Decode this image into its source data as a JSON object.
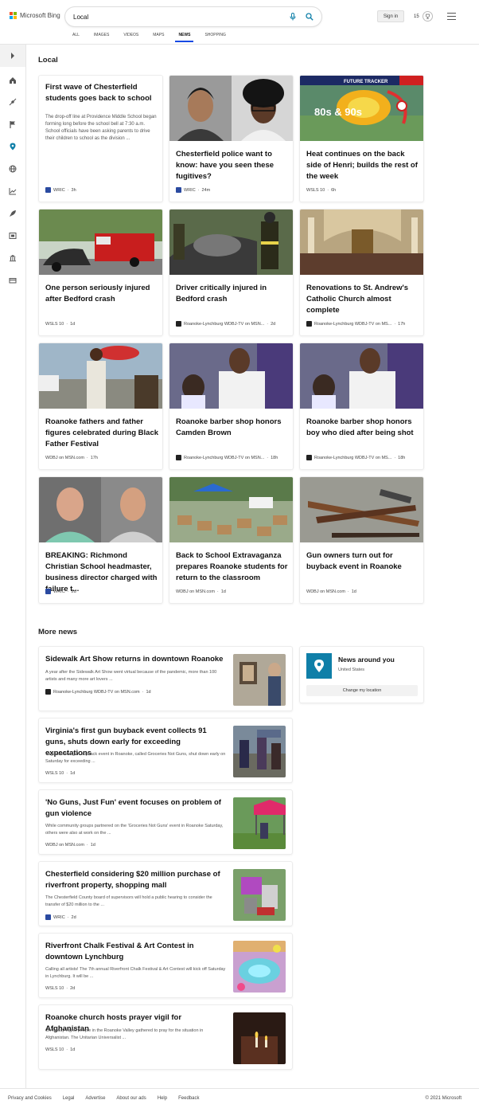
{
  "header": {
    "brand": "Microsoft Bing",
    "search_value": "Local",
    "signin_label": "Sign in",
    "rewards_count": "15",
    "tabs": [
      {
        "label": "ALL",
        "active": false
      },
      {
        "label": "IMAGES",
        "active": false
      },
      {
        "label": "VIDEOS",
        "active": false
      },
      {
        "label": "MAPS",
        "active": false
      },
      {
        "label": "NEWS",
        "active": true
      },
      {
        "label": "SHOPPING",
        "active": false
      }
    ]
  },
  "sidebar": {
    "icons": [
      "expand-icon",
      "home-icon",
      "satellite-icon",
      "flag-icon",
      "location-icon",
      "globe-icon",
      "chart-icon",
      "rocket-icon",
      "film-icon",
      "bank-icon",
      "money-icon"
    ]
  },
  "local": {
    "title": "Local",
    "cards": [
      {
        "title": "First wave of Chesterfield students goes back to school",
        "snippet": "The drop-off line at Providence Middle School began forming long before the school bell at 7:30 a.m. School officials have been asking parents to drive their children to school as the division ...",
        "source": "WRIC",
        "time": "3h"
      },
      {
        "title": "Chesterfield police want to know: have you seen these fugitives?",
        "source": "WRIC",
        "time": "24m"
      },
      {
        "title": "Heat continues on the back side of Henri; builds the rest of the week",
        "source": "WSLS 10",
        "time": "6h",
        "img_text": "80s & 90s",
        "banner_text": "FUTURE TRACKER"
      },
      {
        "title": "One person seriously injured after Bedford crash",
        "source": "WSLS 10",
        "time": "1d"
      },
      {
        "title": "Driver critically injured in Bedford crash",
        "source": "Roanoke-Lynchburg WDBJ-TV on MSN...",
        "time": "2d"
      },
      {
        "title": "Renovations to St. Andrew's Catholic Church almost complete",
        "source": "Roanoke-Lynchburg WDBJ-TV on MS...",
        "time": "17h"
      },
      {
        "title": "Roanoke fathers and father figures celebrated during Black Father Festival",
        "source": "WDBJ on MSN.com",
        "time": "17h"
      },
      {
        "title": "Roanoke barber shop honors Camden Brown",
        "source": "Roanoke-Lynchburg WDBJ-TV on MSN...",
        "time": "18h"
      },
      {
        "title": "Roanoke barber shop honors boy who died after being shot",
        "source": "Roanoke-Lynchburg WDBJ-TV on MS...",
        "time": "18h"
      },
      {
        "title": "BREAKING: Richmond Christian School headmaster, business director charged with failure t...",
        "source": "WRIC",
        "time": "2d"
      },
      {
        "title": "Back to School Extravaganza prepares Roanoke students for return to the classroom",
        "source": "WDBJ on MSN.com",
        "time": "1d"
      },
      {
        "title": "Gun owners turn out for buyback event in Roanoke",
        "source": "WDBJ on MSN.com",
        "time": "1d"
      }
    ]
  },
  "more_news": {
    "title": "More news",
    "items": [
      {
        "title": "Sidewalk Art Show returns in downtown Roanoke",
        "snippet": "A year after the Sidewalk Art Show went virtual because of the pandemic, more than 100 artists and many more art lovers ...",
        "source": "Roanoke-Lynchburg WDBJ-TV on MSN.com",
        "time": "1d"
      },
      {
        "title": "Virginia's first gun buyback event collects 91 guns, shuts down early for exceeding expectations",
        "snippet": "Virginia's first gun buyback event in Roanoke, called Groceries Not Guns, shut down early on Saturday for exceeding ...",
        "source": "WSLS 10",
        "time": "1d"
      },
      {
        "title": "'No Guns, Just Fun' event focuses on problem of gun violence",
        "snippet": "While community groups partnered on the 'Groceries Not Guns' event in Roanoke Saturday, others were also at work on the ...",
        "source": "WDBJ on MSN.com",
        "time": "1d"
      },
      {
        "title": "Chesterfield considering $20 million purchase of riverfront property, shopping mall",
        "snippet": "The Chesterfield County board of supervisors will hold a public hearing to consider the transfer of $20 million to the ...",
        "source": "WRIC",
        "time": "2d"
      },
      {
        "title": "Riverfront Chalk Festival & Art Contest in downtown Lynchburg",
        "snippet": "Calling all artists! The 7th annual Riverfront Chalk Festival & Art Contest will kick off Saturday in Lynchburg. It will be ...",
        "source": "WSLS 10",
        "time": "2d"
      },
      {
        "title": "Roanoke church hosts prayer vigil for Afghanistan",
        "snippet": "On Friday night, people in the Roanoke Valley gathered to pray for the situation in Afghanistan. The Unitarian Universalist ...",
        "source": "WSLS 10",
        "time": "1d"
      }
    ]
  },
  "location_card": {
    "title": "News around you",
    "subtitle": "United States",
    "button": "Change my location"
  },
  "footer": {
    "links": [
      "Privacy and Cookies",
      "Legal",
      "Advertise",
      "About our ads",
      "Help",
      "Feedback"
    ],
    "copyright": "© 2021 Microsoft"
  },
  "colors": {
    "accent": "#174ae4",
    "location_pin": "#0f7fa8"
  }
}
